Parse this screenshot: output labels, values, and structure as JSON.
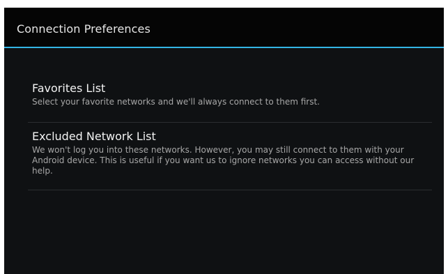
{
  "action_bar": {
    "title": "Connection Preferences",
    "accent_color": "#33b5e5"
  },
  "preferences": [
    {
      "title": "Favorites List",
      "summary": "Select your favorite networks and we'll always connect to them first."
    },
    {
      "title": "Excluded Network List",
      "summary": "We won't log you into these networks. However, you may still connect to them with your Android device. This is useful if you want us to ignore networks you can access without our help."
    }
  ]
}
